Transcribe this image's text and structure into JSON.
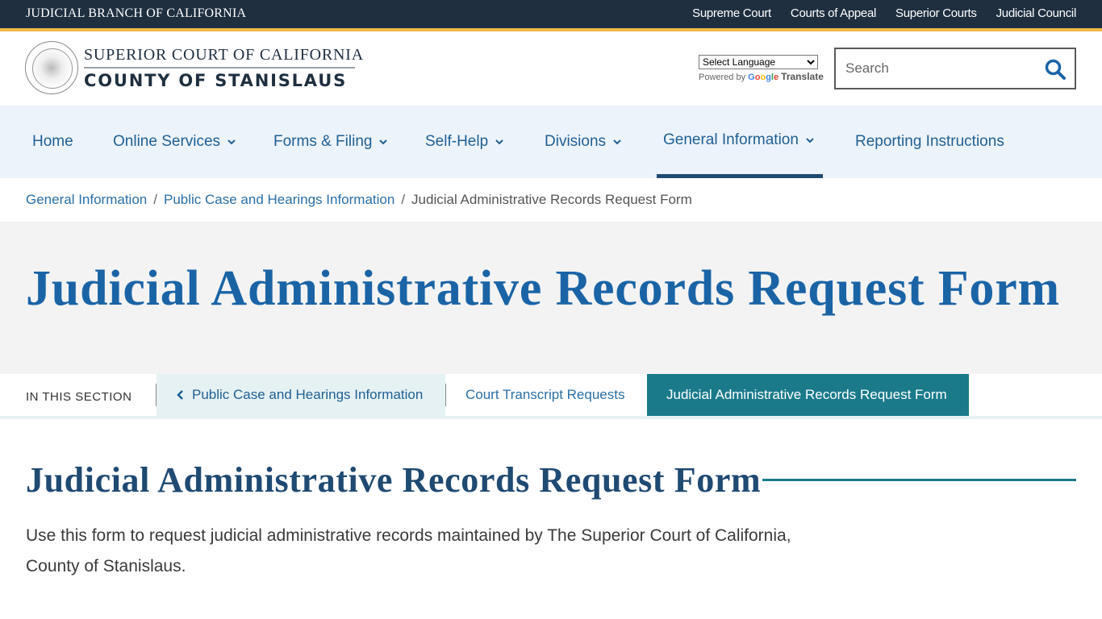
{
  "topbar": {
    "title": "JUDICIAL BRANCH OF CALIFORNIA",
    "links": [
      "Supreme Court",
      "Courts of Appeal",
      "Superior Courts",
      "Judicial Council"
    ]
  },
  "header": {
    "logo_line1": "SUPERIOR COURT OF CALIFORNIA",
    "logo_line2": "COUNTY OF STANISLAUS",
    "seal_icon": "judicial-branch-seal",
    "language": {
      "selected": "Select Language",
      "powered_by": "Powered by",
      "google": [
        "G",
        "o",
        "o",
        "g",
        "l",
        "e"
      ],
      "translate": "Translate"
    },
    "search": {
      "placeholder": "Search",
      "value": "",
      "icon": "search-icon"
    }
  },
  "nav": {
    "items": [
      {
        "label": "Home",
        "dropdown": false,
        "active": false
      },
      {
        "label": "Online Services",
        "dropdown": true,
        "active": false
      },
      {
        "label": "Forms & Filing",
        "dropdown": true,
        "active": false
      },
      {
        "label": "Self-Help",
        "dropdown": true,
        "active": false
      },
      {
        "label": "Divisions",
        "dropdown": true,
        "active": false
      },
      {
        "label": "General Information",
        "dropdown": true,
        "active": true
      },
      {
        "label": "Reporting Instructions",
        "dropdown": false,
        "active": false
      }
    ]
  },
  "breadcrumb": {
    "items": [
      "General Information",
      "Public Case and Hearings Information"
    ],
    "current": "Judicial Administrative Records Request Form",
    "separator": "/"
  },
  "hero": {
    "title": "Judicial Administrative Records Request Form"
  },
  "section_nav": {
    "label": "IN THIS SECTION",
    "parent": "Public Case and Hearings Information",
    "items": [
      "Court Transcript Requests",
      "Judicial Administrative Records Request Form"
    ],
    "current_index": 1
  },
  "content": {
    "title": "Judicial Administrative Records Request Form",
    "body": "Use this form to request judicial administrative records maintained by The Superior Court of California, County of Stanislaus."
  },
  "colors": {
    "topbar": "#1f2f40",
    "gold_accent": "#f0b945",
    "link_blue": "#1f5f94",
    "hero_title": "#1a64a6",
    "teal": "#1a7a8a",
    "nav_bg": "#ecf3fa"
  }
}
